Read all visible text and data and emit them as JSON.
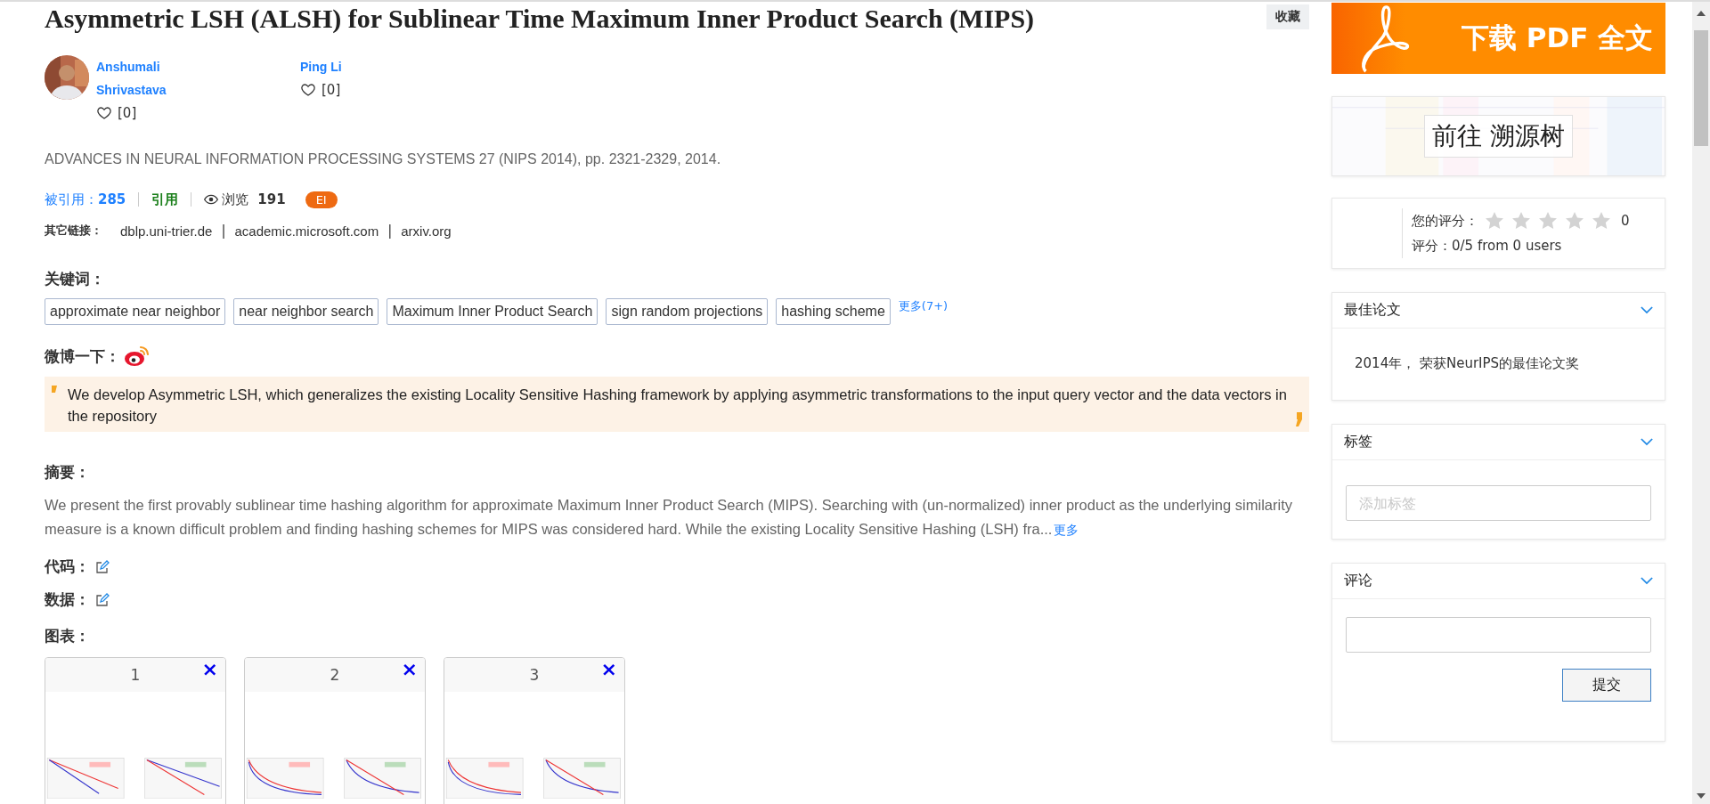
{
  "title": "Asymmetric LSH (ALSH) for Sublinear Time Maximum Inner Product Search (MIPS)",
  "favorite_button": "收藏",
  "authors": [
    {
      "name": "Anshumali Shrivastava",
      "likes": "[0]"
    },
    {
      "name": "Ping Li",
      "likes": "[0]"
    }
  ],
  "venue": "ADVANCES IN NEURAL INFORMATION PROCESSING SYSTEMS 27 (NIPS 2014), pp. 2321-2329, 2014.",
  "stats": {
    "cited_label": "被引用：",
    "cited_count": "285",
    "cite_link": "引用",
    "views_label": "浏览",
    "views_count": "191",
    "badge": "EI"
  },
  "other_links": {
    "label": "其它链接：",
    "separator": "|",
    "links": [
      "dblp.uni-trier.de",
      "academic.microsoft.com",
      "arxiv.org"
    ]
  },
  "keywords": {
    "label": "关键词：",
    "items": [
      "approximate near neighbor",
      "near neighbor search",
      "Maximum Inner Product Search",
      "sign random projections",
      "hashing scheme"
    ],
    "more": "更多(7+)"
  },
  "weibo": {
    "label": "微博一下：",
    "quote": "We develop Asymmetric LSH, which generalizes the existing Locality Sensitive Hashing framework by applying asymmetric transformations to the input query vector and the data vectors in the repository"
  },
  "abstract": {
    "label": "摘要：",
    "text": "We present the first provably sublinear time hashing algorithm for approximate Maximum Inner Product Search (MIPS). Searching with (un-normalized) inner product as the underlying similarity measure is a known difficult problem and finding hashing schemes for MIPS was considered hard. While the existing Locality Sensitive Hashing (LSH) fra...",
    "more": "更多"
  },
  "code": {
    "label": "代码："
  },
  "data": {
    "label": "数据："
  },
  "figures": {
    "label": "图表：",
    "items": [
      {
        "number": "1",
        "close": "×"
      },
      {
        "number": "2",
        "close": "×"
      },
      {
        "number": "3",
        "close": "×"
      }
    ]
  },
  "sidebar": {
    "download_banner": "下载 PDF 全文",
    "trace_tree": "前往 溯源树",
    "rating": {
      "your_label": "您的评分：",
      "stars": 0,
      "your_score": "0",
      "summary": "评分：0/5 from 0 users"
    },
    "panels": [
      {
        "kind": "text",
        "title": "最佳论文",
        "text": "2014年， 荣获NeurIPS的最佳论文奖"
      },
      {
        "kind": "tag_input",
        "title": "标签",
        "placeholder": "添加标签"
      },
      {
        "kind": "comment",
        "title": "评论",
        "button": "提交"
      }
    ]
  }
}
